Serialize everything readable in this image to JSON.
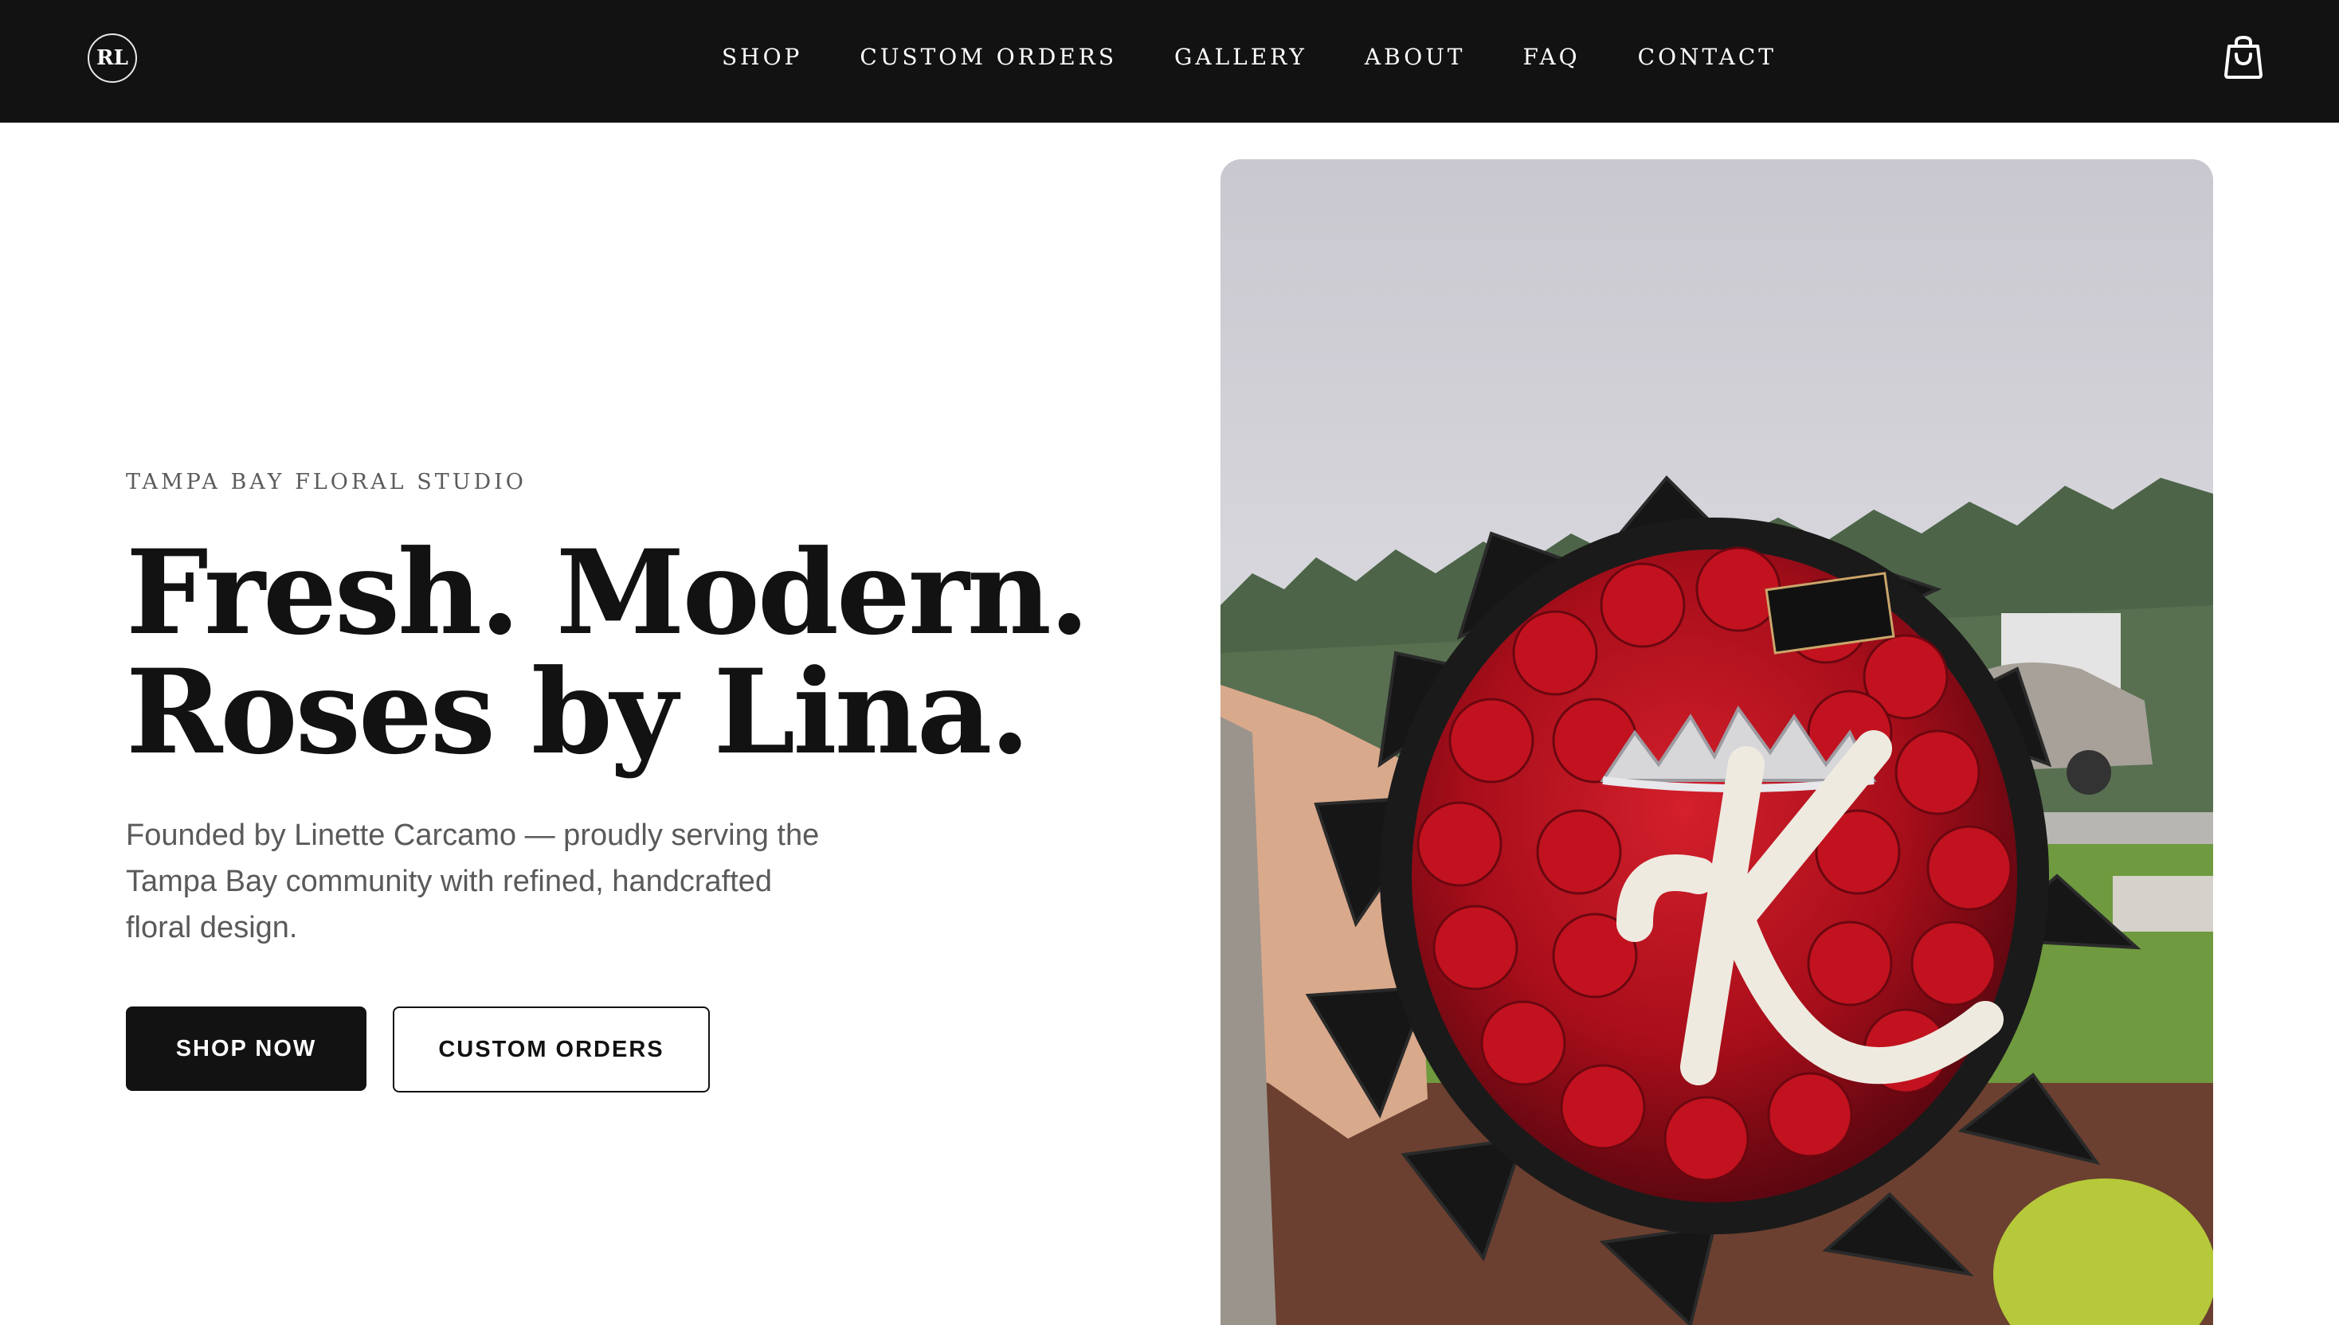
{
  "header": {
    "logo_text": "RL",
    "nav": [
      {
        "label": "SHOP"
      },
      {
        "label": "CUSTOM ORDERS"
      },
      {
        "label": "GALLERY"
      },
      {
        "label": "ABOUT"
      },
      {
        "label": "FAQ"
      },
      {
        "label": "CONTACT"
      }
    ],
    "cart_icon": "shopping-bag-icon"
  },
  "hero": {
    "eyebrow": "TAMPA BAY FLORAL STUDIO",
    "headline_line1": "Fresh. Modern.",
    "headline_line2": "Roses by Lina.",
    "description": "Founded by Linette Carcamo — proudly serving the Tampa Bay community with refined, handcrafted floral design.",
    "primary_button": "SHOP NOW",
    "secondary_button": "CUSTOM ORDERS",
    "image": {
      "monogram_letter": "K",
      "subject": "red-rose-bouquet-with-tiara"
    }
  },
  "colors": {
    "header_bg": "#121212",
    "text_dark": "#121212",
    "text_muted": "#5a5a5a",
    "rose_red": "#b3101c"
  }
}
